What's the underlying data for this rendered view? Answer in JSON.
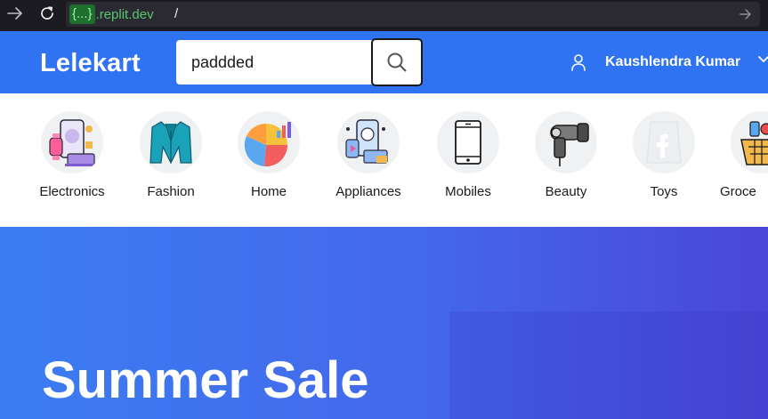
{
  "browser": {
    "url_badge": "{...}",
    "url_domain": ".replit.dev",
    "url_path": "/",
    "icons": [
      "back-arrow-icon",
      "reload-icon",
      "go-arrow-icon"
    ]
  },
  "header": {
    "logo": "Lelekart",
    "search": {
      "value": "paddded",
      "icon": "search-icon"
    },
    "user": {
      "name": "Kaushlendra Kumar",
      "icon": "user-icon",
      "menu_icon": "chevron-down-icon"
    },
    "colors": {
      "header_bg": "#2f73f3",
      "text": "#ffffff"
    }
  },
  "categories": [
    {
      "label": "Electronics",
      "icon": "electronics-icon"
    },
    {
      "label": "Fashion",
      "icon": "blazer-icon"
    },
    {
      "label": "Home",
      "icon": "pie-chart-icon"
    },
    {
      "label": "Appliances",
      "icon": "appliances-icon"
    },
    {
      "label": "Mobiles",
      "icon": "smartphone-icon"
    },
    {
      "label": "Beauty",
      "icon": "hair-dryer-icon"
    },
    {
      "label": "Toys",
      "icon": "facebook-logo-icon"
    },
    {
      "label": "Groce",
      "icon": "grocery-basket-icon"
    }
  ],
  "hero": {
    "title": "Summer Sale",
    "colors": {
      "gradient_start": "#3b7df3",
      "gradient_end": "#4a47d6"
    }
  }
}
